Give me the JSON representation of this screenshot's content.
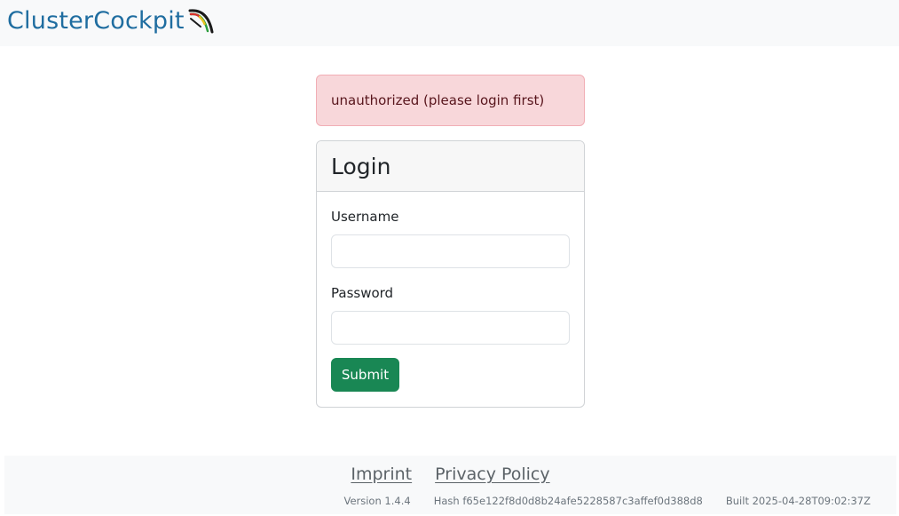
{
  "header": {
    "brand": "ClusterCockpit",
    "logo_icon": "gauge-arc-icon"
  },
  "alert": {
    "message": "unauthorized (please login first)"
  },
  "login": {
    "title": "Login",
    "username_label": "Username",
    "username_value": "",
    "password_label": "Password",
    "password_value": "",
    "submit_label": "Submit"
  },
  "footer": {
    "links": [
      "Imprint",
      "Privacy Policy"
    ],
    "version": "Version 1.4.4",
    "hash": "Hash f65e122f8d0d8b24afe5228587c3affef0d388d8",
    "built": "Built 2025-04-28T09:02:37Z"
  },
  "colors": {
    "brand": "#1f6da0",
    "alert_bg": "#f8d7da",
    "alert_text": "#58151c",
    "submit_bg": "#198754"
  }
}
